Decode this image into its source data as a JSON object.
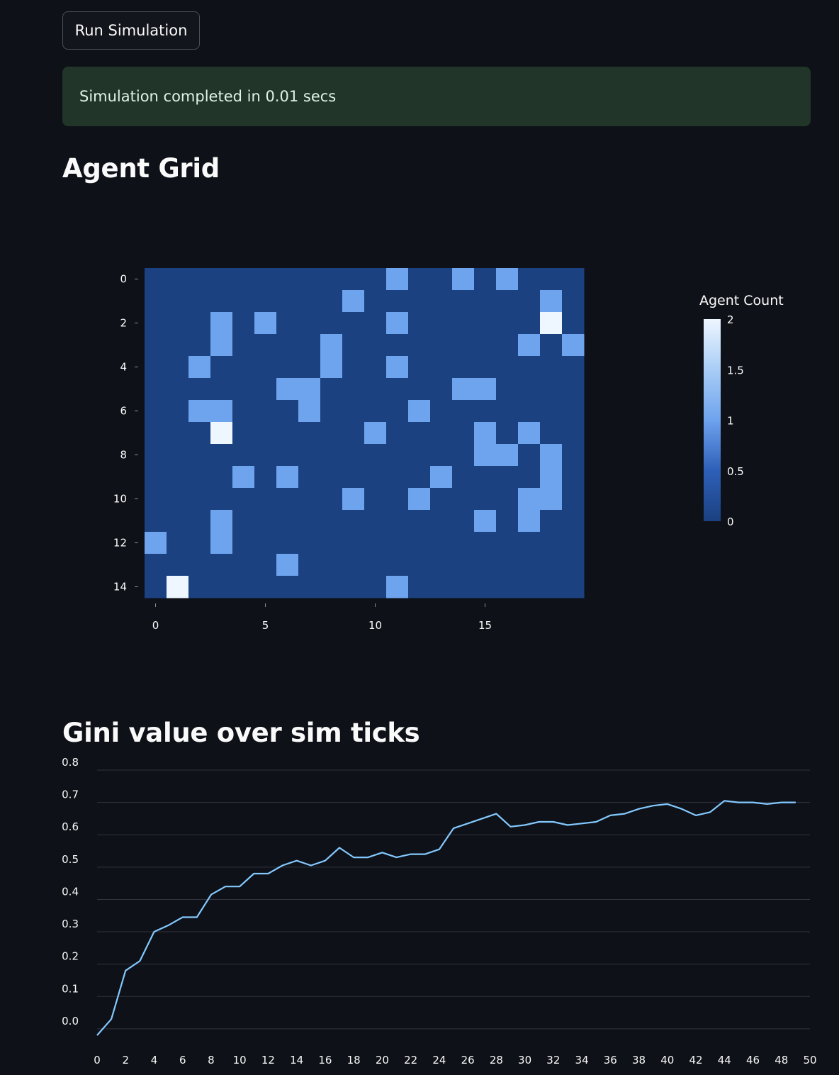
{
  "run_button": {
    "label": "Run Simulation"
  },
  "status_message": "Simulation completed in 0.01 secs",
  "headings": {
    "grid": "Agent Grid",
    "gini": "Gini value over sim ticks"
  },
  "colors": {
    "background": "#0e1117",
    "success_bg": "#213529",
    "heat_low": "#1b4180",
    "heat_mid": "#6ea3ee",
    "heat_high": "#eef6ff",
    "line": "#83c9ff",
    "gridline": "#31333f"
  },
  "chart_data": [
    {
      "type": "heatmap",
      "title": "Agent Grid",
      "rows": 15,
      "cols": 20,
      "cells": [
        [
          0,
          0,
          0,
          0,
          0,
          0,
          0,
          0,
          0,
          0,
          0,
          1,
          0,
          0,
          1,
          0,
          1,
          0,
          0,
          0
        ],
        [
          0,
          0,
          0,
          0,
          0,
          0,
          0,
          0,
          0,
          1,
          0,
          0,
          0,
          0,
          0,
          0,
          0,
          0,
          1,
          0
        ],
        [
          0,
          0,
          0,
          1,
          0,
          1,
          0,
          0,
          0,
          0,
          0,
          1,
          0,
          0,
          0,
          0,
          0,
          0,
          2,
          0
        ],
        [
          0,
          0,
          0,
          1,
          0,
          0,
          0,
          0,
          1,
          0,
          0,
          0,
          0,
          0,
          0,
          0,
          0,
          1,
          0,
          1
        ],
        [
          0,
          0,
          1,
          0,
          0,
          0,
          0,
          0,
          1,
          0,
          0,
          1,
          0,
          0,
          0,
          0,
          0,
          0,
          0,
          0
        ],
        [
          0,
          0,
          0,
          0,
          0,
          0,
          1,
          1,
          0,
          0,
          0,
          0,
          0,
          0,
          1,
          1,
          0,
          0,
          0,
          0
        ],
        [
          0,
          0,
          1,
          1,
          0,
          0,
          0,
          1,
          0,
          0,
          0,
          0,
          1,
          0,
          0,
          0,
          0,
          0,
          0,
          0
        ],
        [
          0,
          0,
          0,
          2,
          0,
          0,
          0,
          0,
          0,
          0,
          1,
          0,
          0,
          0,
          0,
          1,
          0,
          1,
          0,
          0
        ],
        [
          0,
          0,
          0,
          0,
          0,
          0,
          0,
          0,
          0,
          0,
          0,
          0,
          0,
          0,
          0,
          1,
          1,
          0,
          1,
          0
        ],
        [
          0,
          0,
          0,
          0,
          1,
          0,
          1,
          0,
          0,
          0,
          0,
          0,
          0,
          1,
          0,
          0,
          0,
          0,
          1,
          0
        ],
        [
          0,
          0,
          0,
          0,
          0,
          0,
          0,
          0,
          0,
          1,
          0,
          0,
          1,
          0,
          0,
          0,
          0,
          1,
          1,
          0
        ],
        [
          0,
          0,
          0,
          1,
          0,
          0,
          0,
          0,
          0,
          0,
          0,
          0,
          0,
          0,
          0,
          1,
          0,
          1,
          0,
          0
        ],
        [
          1,
          0,
          0,
          1,
          0,
          0,
          0,
          0,
          0,
          0,
          0,
          0,
          0,
          0,
          0,
          0,
          0,
          0,
          0,
          0
        ],
        [
          0,
          0,
          0,
          0,
          0,
          0,
          1,
          0,
          0,
          0,
          0,
          0,
          0,
          0,
          0,
          0,
          0,
          0,
          0,
          0
        ],
        [
          0,
          2,
          0,
          0,
          0,
          0,
          0,
          0,
          0,
          0,
          0,
          1,
          0,
          0,
          0,
          0,
          0,
          0,
          0,
          0
        ]
      ],
      "x_ticks": [
        "0",
        "5",
        "10",
        "15"
      ],
      "y_ticks": [
        "0",
        "2",
        "4",
        "6",
        "8",
        "10",
        "12",
        "14"
      ],
      "colorbar": {
        "title": "Agent Count",
        "range": [
          0,
          2
        ],
        "ticks": [
          "2",
          "1.5",
          "1",
          "0.5",
          "0"
        ]
      }
    },
    {
      "type": "line",
      "title": "Gini value over sim ticks",
      "x": [
        0,
        1,
        2,
        3,
        4,
        5,
        6,
        7,
        8,
        9,
        10,
        11,
        12,
        13,
        14,
        15,
        16,
        17,
        18,
        19,
        20,
        21,
        22,
        23,
        24,
        25,
        26,
        27,
        28,
        29,
        30,
        31,
        32,
        33,
        34,
        35,
        36,
        37,
        38,
        39,
        40,
        41,
        42,
        43,
        44,
        45,
        46,
        47,
        48,
        49
      ],
      "y": [
        -0.02,
        0.03,
        0.18,
        0.21,
        0.3,
        0.32,
        0.345,
        0.345,
        0.415,
        0.44,
        0.44,
        0.48,
        0.48,
        0.505,
        0.52,
        0.505,
        0.52,
        0.56,
        0.53,
        0.53,
        0.545,
        0.53,
        0.54,
        0.54,
        0.555,
        0.62,
        0.635,
        0.65,
        0.665,
        0.625,
        0.63,
        0.64,
        0.64,
        0.63,
        0.635,
        0.64,
        0.66,
        0.665,
        0.68,
        0.69,
        0.695,
        0.68,
        0.66,
        0.67,
        0.705,
        0.7,
        0.7,
        0.695,
        0.7,
        0.7
      ],
      "x_ticks": [
        "0",
        "2",
        "4",
        "6",
        "8",
        "10",
        "12",
        "14",
        "16",
        "18",
        "20",
        "22",
        "24",
        "26",
        "28",
        "30",
        "32",
        "34",
        "36",
        "38",
        "40",
        "42",
        "44",
        "46",
        "48",
        "50"
      ],
      "y_ticks": [
        "0.0",
        "0.1",
        "0.2",
        "0.3",
        "0.4",
        "0.5",
        "0.6",
        "0.7",
        "0.8"
      ],
      "xlim": [
        0,
        50
      ],
      "ylim": [
        -0.02,
        0.8
      ],
      "grid": true
    }
  ]
}
